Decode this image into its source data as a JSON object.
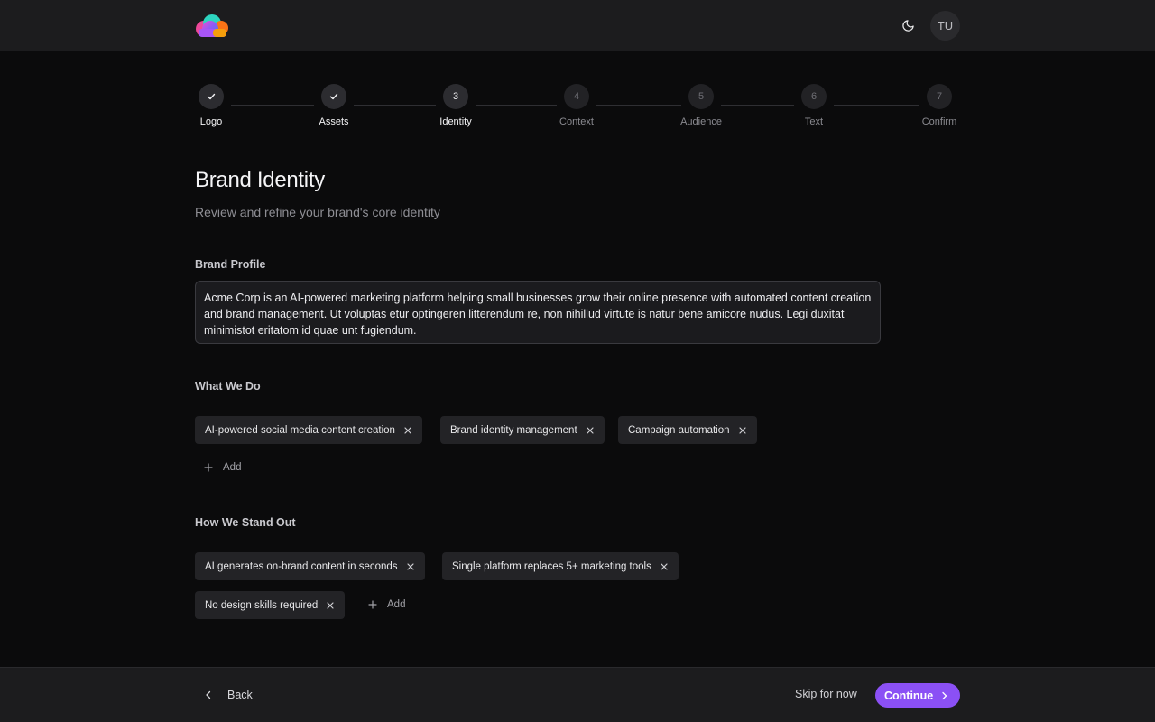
{
  "header": {
    "user_initials": "TU"
  },
  "stepper": {
    "steps": [
      {
        "label": "Logo",
        "number": "1",
        "state": "done"
      },
      {
        "label": "Assets",
        "number": "2",
        "state": "done"
      },
      {
        "label": "Identity",
        "number": "3",
        "state": "active"
      },
      {
        "label": "Context",
        "number": "4",
        "state": "pending"
      },
      {
        "label": "Audience",
        "number": "5",
        "state": "pending"
      },
      {
        "label": "Text",
        "number": "6",
        "state": "pending"
      },
      {
        "label": "Confirm",
        "number": "7",
        "state": "pending"
      }
    ]
  },
  "page": {
    "title": "Brand Identity",
    "subtitle": "Review and refine your brand's core identity"
  },
  "brand_profile": {
    "label": "Brand Profile",
    "value": "Acme Corp is an AI-powered marketing platform helping small businesses grow their online presence with automated content creation and brand management. Ut voluptas etur optingeren litterendum re, non nihillud virtute is natur bene amicore nudus. Legi duxitat minimistot eritatom id quae unt fugiendum."
  },
  "what_we_do": {
    "label": "What We Do",
    "tags": [
      "AI-powered social media content creation",
      "Brand identity management",
      "Campaign automation"
    ],
    "add_label": "Add"
  },
  "stand_out": {
    "label": "How We Stand Out",
    "tags": [
      "AI generates on-brand content in seconds",
      "Single platform replaces 5+ marketing tools",
      "No design skills required"
    ],
    "add_label": "Add"
  },
  "footer": {
    "back_label": "Back",
    "skip_label": "Skip for now",
    "continue_label": "Continue"
  },
  "colors": {
    "accent": "#8b50f5",
    "background": "#0b0b0c",
    "surface": "#1c1c1e"
  }
}
